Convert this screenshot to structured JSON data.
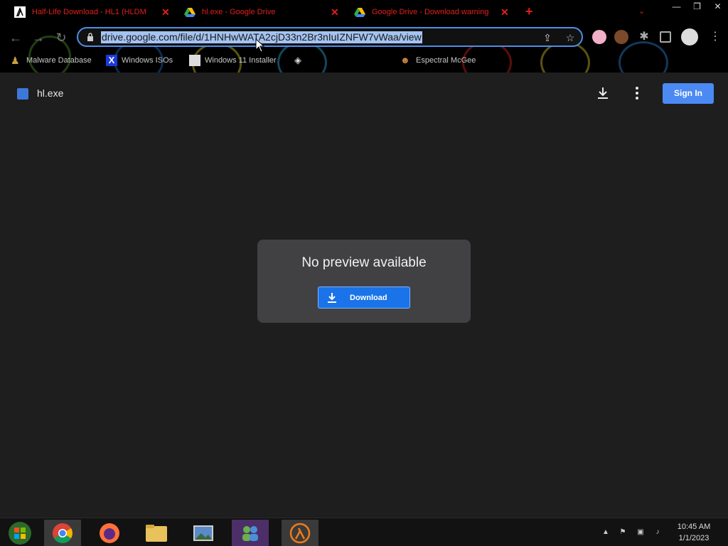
{
  "browser": {
    "tabs": [
      {
        "title": "Half-Life Download - HL1 (HLDM",
        "close": "✕"
      },
      {
        "title": "hl.exe - Google Drive",
        "close": "✕"
      },
      {
        "title": "Google Drive - Download warning",
        "close": "✕"
      }
    ],
    "new_tab": "+",
    "tab_list": "⌄",
    "window_buttons": {
      "minimize": "—",
      "restore": "❐",
      "close": "✕"
    },
    "url": "drive.google.com/file/d/1HNHwWATA2cjD33n2Br3nIuIZNFW7vWaa/view",
    "bookmarks": [
      {
        "label": "Malware Database"
      },
      {
        "label": "Windows ISOs"
      },
      {
        "label": "Windows 11 Installer"
      },
      {
        "label": ""
      },
      {
        "label": "Espectral McGee"
      }
    ]
  },
  "drive": {
    "file_name": "hl.exe",
    "sign_in": "Sign In",
    "preview_message": "No preview available",
    "download_label": "Download"
  },
  "taskbar": {
    "time": "10:45 AM",
    "date": "1/1/2023",
    "tray_chevron": "▲"
  },
  "colors": {
    "accent": "#1a73e8",
    "tab_text": "#e0201b",
    "url_highlight": "#a4c3f1"
  }
}
